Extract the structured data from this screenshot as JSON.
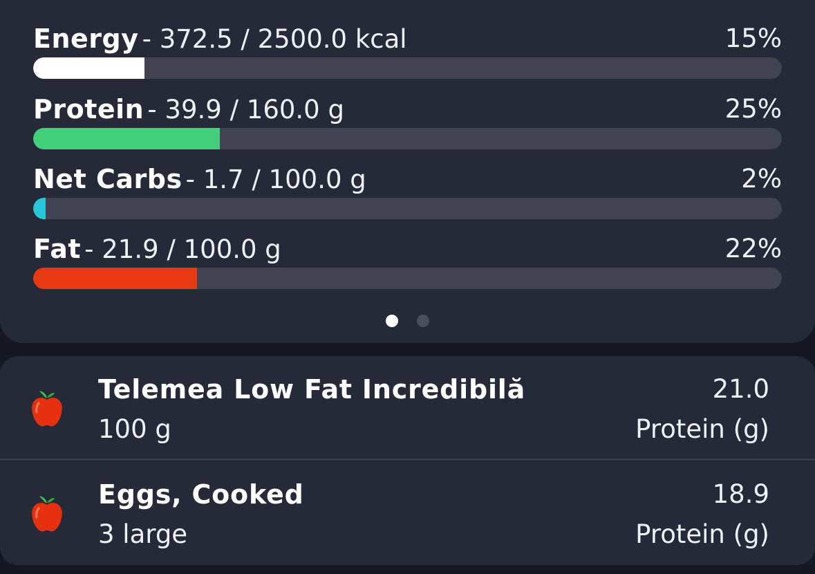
{
  "nutrients": [
    {
      "name": "Energy",
      "amount": "- 372.5 / 2500.0 kcal",
      "percent": "15%",
      "progress": 0.149,
      "color": "#ffffff"
    },
    {
      "name": "Protein",
      "amount": "- 39.9 / 160.0 g",
      "percent": "25%",
      "progress": 0.249,
      "color": "#44d07a"
    },
    {
      "name": "Net Carbs",
      "amount": "- 1.7 / 100.0 g",
      "percent": "2%",
      "progress": 0.017,
      "color": "#27c7da"
    },
    {
      "name": "Fat",
      "amount": "- 21.9 / 100.0 g",
      "percent": "22%",
      "progress": 0.219,
      "color": "#e8380f"
    }
  ],
  "pager": {
    "pages": 2,
    "active": 1,
    "active_color": "#ffffff",
    "inactive_color": "#4a4d5e"
  },
  "foods": [
    {
      "name": "Telemea Low Fat Incredibilă",
      "quantity": "100 g",
      "value": "21.0",
      "unit": "Protein (g)",
      "icon": "apple-icon"
    },
    {
      "name": "Eggs, Cooked",
      "quantity": "3 large",
      "value": "18.9",
      "unit": "Protein (g)",
      "icon": "apple-icon"
    }
  ]
}
